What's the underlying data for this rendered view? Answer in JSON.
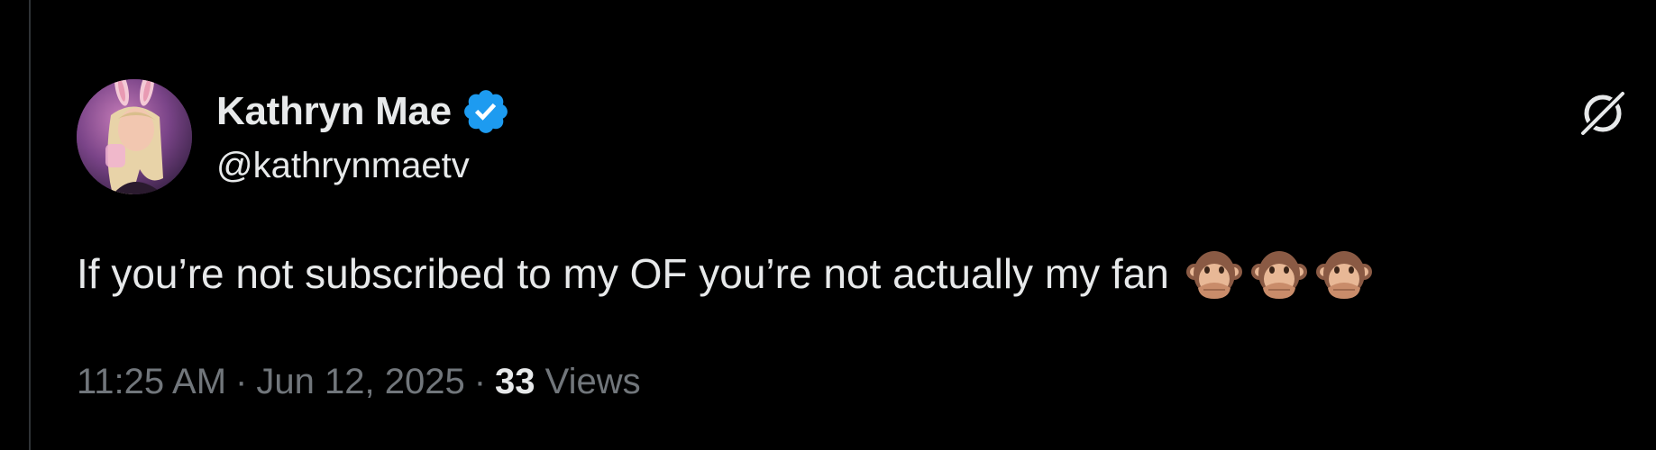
{
  "tweet": {
    "author": {
      "display_name": "Kathryn Mae",
      "handle": "@kathrynmaetv",
      "verified": true,
      "verified_badge_color": "#1d9bf0"
    },
    "text": "If you’re not subscribed to my OF you’re not actually my fan",
    "emojis": [
      "speak-no-evil-monkey",
      "speak-no-evil-monkey",
      "speak-no-evil-monkey"
    ],
    "time": "11:25 AM",
    "date": "Jun 12, 2025",
    "separator": "·",
    "views_count": "33",
    "views_label": "Views"
  },
  "icons": {
    "grok": "grok-icon",
    "verified": "verified-badge-icon"
  },
  "colors": {
    "background": "#000000",
    "text_primary": "#e7e9ea",
    "text_secondary": "#71767b",
    "border": "#2f3336"
  }
}
